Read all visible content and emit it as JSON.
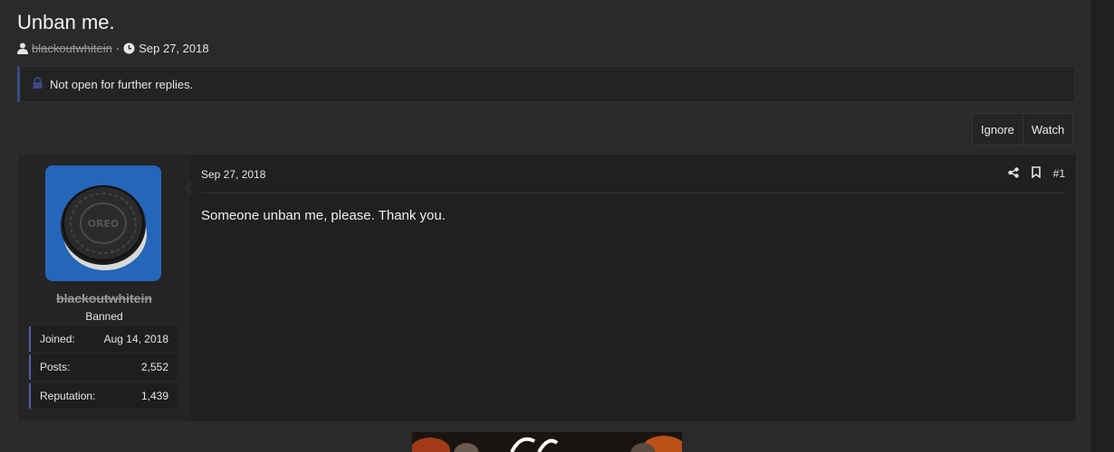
{
  "thread": {
    "title": "Unban me.",
    "author": "blackoutwhitein",
    "separator": "·",
    "date": "Sep 27, 2018",
    "notice": "Not open for further replies."
  },
  "actions": {
    "ignore": "Ignore",
    "watch": "Watch"
  },
  "post": {
    "date": "Sep 27, 2018",
    "number": "#1",
    "body": "Someone unban me, please. Thank you."
  },
  "user": {
    "name": "blackoutwhitein",
    "title": "Banned",
    "avatar_text": "OREO",
    "stats": [
      {
        "label": "Joined:",
        "value": "Aug 14, 2018"
      },
      {
        "label": "Posts:",
        "value": "2,552"
      },
      {
        "label": "Reputation:",
        "value": "1,439"
      }
    ]
  },
  "colors": {
    "accent": "#3b4a87",
    "avatar_bg": "#2466b8",
    "stat_border": "#5560b0"
  }
}
